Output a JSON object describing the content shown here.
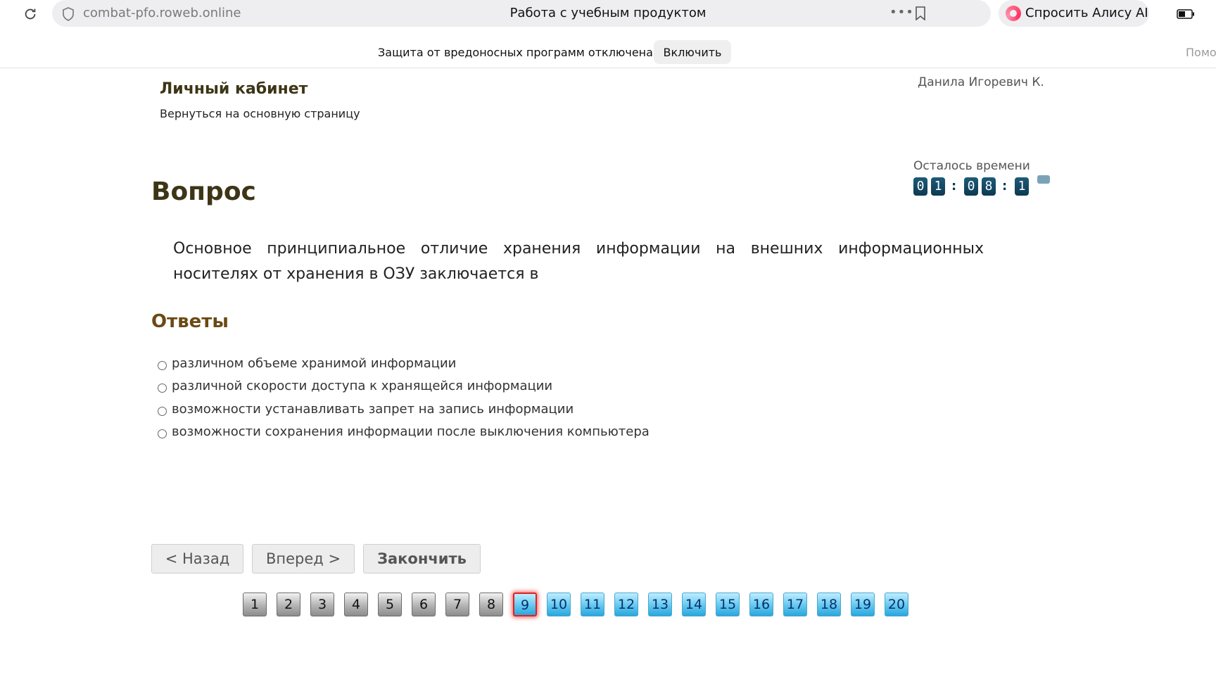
{
  "browser": {
    "url": "combat-pfo.roweb.online",
    "tab_title": "Работа с учебным продуктом",
    "alice_label": "Спросить Алису AI"
  },
  "notice": {
    "text": "Защита от вредоносных программ отключена",
    "button": "Включить",
    "help_partial": "Помощь"
  },
  "header": {
    "title": "Личный кабинет",
    "back_link": "Вернуться на основную страницу",
    "user": "Данила Игоревич К."
  },
  "timer": {
    "label": "Осталось времени",
    "d1": "0",
    "d2": "1",
    "sep1": ":",
    "d3": "0",
    "d4": "8",
    "sep2": ":",
    "d5": "1"
  },
  "question": {
    "heading": "Вопрос",
    "text": "Основное принципиальное отличие хранения информации на внешних информационных носителях от хранения в ОЗУ заключается в"
  },
  "answers": {
    "heading": "Ответы",
    "items": [
      "различном объеме хранимой информации",
      "различной скорости доступа к хранящейся информации",
      "возможности устанавливать запрет на запись информации",
      "возможности сохранения информации после выключения компьютера"
    ]
  },
  "nav": {
    "back": "< Назад",
    "next": "Вперед >",
    "finish": "Закончить"
  },
  "pages": [
    "1",
    "2",
    "3",
    "4",
    "5",
    "6",
    "7",
    "8",
    "9",
    "10",
    "11",
    "12",
    "13",
    "14",
    "15",
    "16",
    "17",
    "18",
    "19",
    "20"
  ],
  "current_page": 9
}
